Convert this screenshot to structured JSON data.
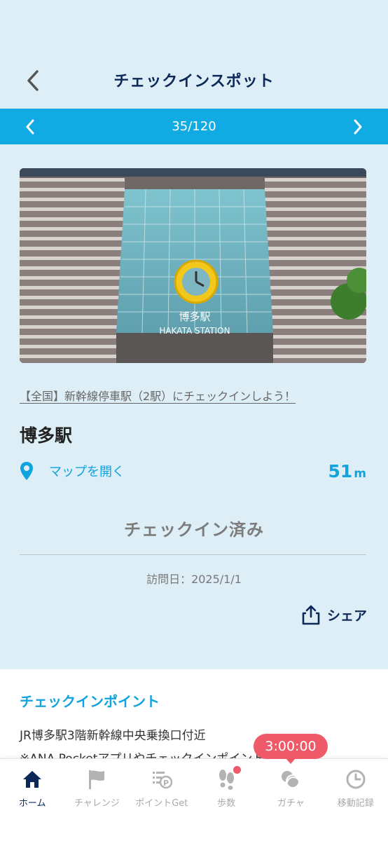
{
  "header": {
    "title": "チェックインスポット"
  },
  "pager": {
    "position": "35/120"
  },
  "spot": {
    "photo_sign_main": "博多駅",
    "photo_sign_en": "HAKATA STATION",
    "campaign_link": "【全国】新幹線停車駅（2駅）にチェックインしよう！",
    "name": "博多駅",
    "map_link_label": "マップを開く",
    "distance_value": "51",
    "distance_unit": "m",
    "status": "チェックイン済み",
    "visit_date": "訪問日：2025/1/1",
    "share_label": "シェア"
  },
  "info": {
    "title": "チェックインポイント",
    "lines": [
      "JR博多駅3階新幹線中央乗換口付近",
      "※ANA Pocketアプリやチェックインポイントに関す"
    ]
  },
  "timer": {
    "value": "3:00:00"
  },
  "tabs": [
    {
      "label": "ホーム",
      "icon": "home-icon",
      "active": true
    },
    {
      "label": "チャレンジ",
      "icon": "flag-icon",
      "active": false
    },
    {
      "label": "ポイントGet",
      "icon": "point-get-icon",
      "active": false
    },
    {
      "label": "歩数",
      "icon": "footsteps-icon",
      "active": false,
      "badge": true
    },
    {
      "label": "ガチャ",
      "icon": "gacha-icon",
      "active": false
    },
    {
      "label": "移動記録",
      "icon": "clock-icon",
      "active": false
    }
  ],
  "colors": {
    "background": "#ddeef6",
    "accent": "#11abe3",
    "navy": "#0c2859",
    "badge": "#ee5a67"
  }
}
